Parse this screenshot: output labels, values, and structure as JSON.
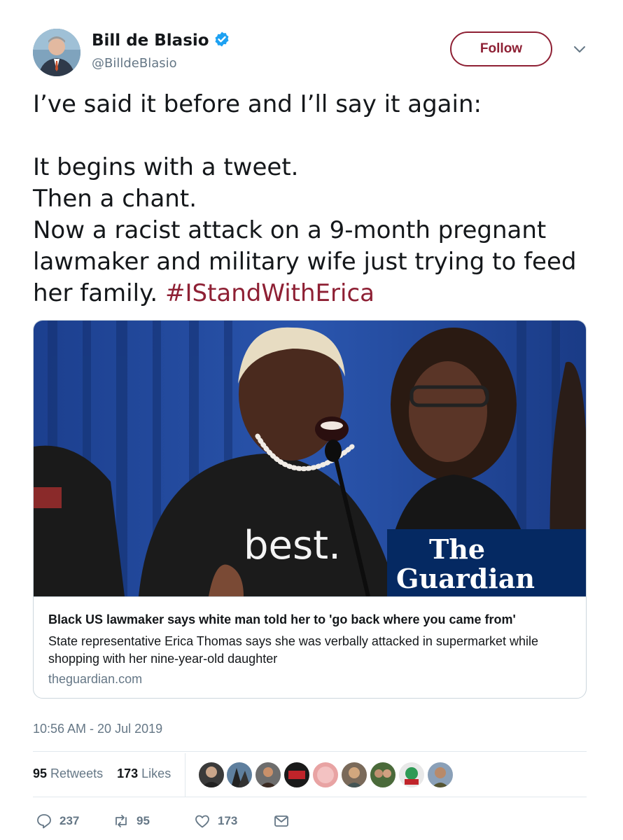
{
  "author": {
    "name": "Bill de Blasio",
    "handle": "@BilldeBlasio",
    "verified": true
  },
  "follow_label": "Follow",
  "tweet": {
    "lines": [
      "I’ve said it before and I’ll say it again:",
      "",
      "It begins with a tweet.",
      "Then a chant.",
      "Now a racist attack on a 9-month pregnant",
      "lawmaker and military wife just trying to feed"
    ],
    "last_line_text": "her family.",
    "hashtag": "#IStandWithErica"
  },
  "card": {
    "image_overlay_text": "best.",
    "logo_line1": "The",
    "logo_line2": "Guardian",
    "title": "Black US lawmaker says white man told her to 'go back where you came from'",
    "description": "State representative Erica Thomas says she was verbally attacked in supermarket while shopping with her nine-year-old daughter",
    "domain": "theguardian.com"
  },
  "timestamp": "10:56 AM - 20 Jul 2019",
  "stats": {
    "retweets_count": "95",
    "retweets_label": "Retweets",
    "likes_count": "173",
    "likes_label": "Likes"
  },
  "actions": {
    "replies": "237",
    "retweets": "95",
    "likes": "173"
  },
  "colors": {
    "accent": "#8e2034",
    "text": "#14171a",
    "muted": "#657786",
    "verified": "#1da1f2",
    "guardian_blue": "#052962"
  }
}
